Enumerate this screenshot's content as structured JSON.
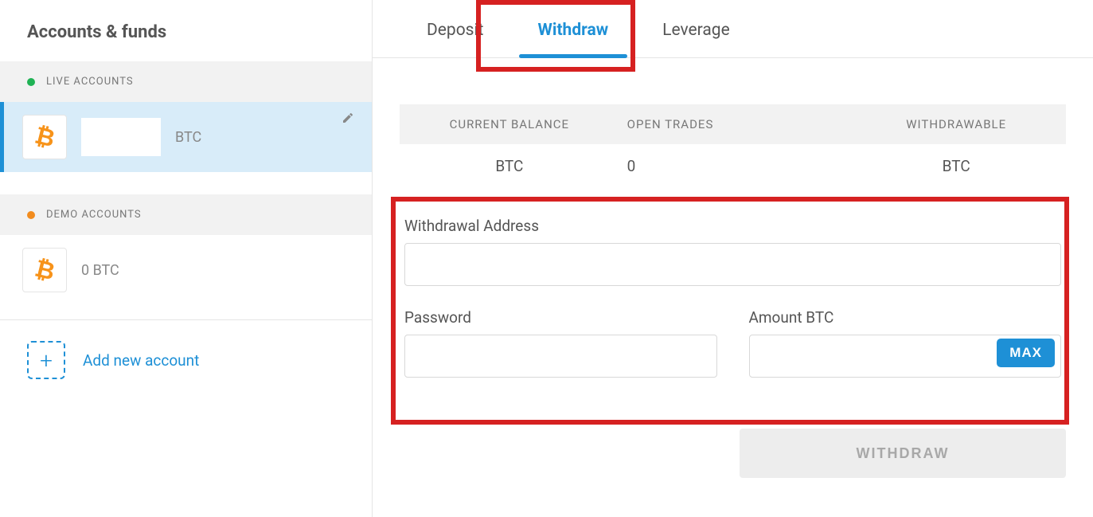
{
  "sidebar": {
    "title": "Accounts & funds",
    "live_header": "LIVE ACCOUNTS",
    "demo_header": "DEMO ACCOUNTS",
    "live_account": {
      "suffix": "BTC"
    },
    "demo_account": {
      "balance": "0 BTC"
    },
    "add_label": "Add new account"
  },
  "tabs": {
    "deposit": "Deposit",
    "withdraw": "Withdraw",
    "leverage": "Leverage"
  },
  "balance": {
    "h_current": "CURRENT BALANCE",
    "h_open": "OPEN TRADES",
    "h_withdrawable": "WITHDRAWABLE",
    "v_current": "BTC",
    "v_open": "0",
    "v_withdrawable": "BTC"
  },
  "form": {
    "addr_label": "Withdrawal Address",
    "pw_label": "Password",
    "amt_label": "Amount BTC",
    "max_label": "MAX",
    "submit_label": "WITHDRAW"
  }
}
